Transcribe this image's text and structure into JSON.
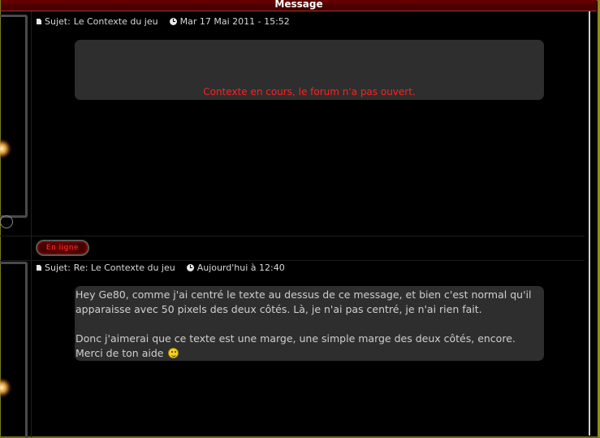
{
  "header": {
    "title": "Message"
  },
  "posts": [
    {
      "subject_prefix": "Sujet:",
      "subject": "Le Contexte du jeu",
      "date": "Mar 17 Mai 2011 - 15:52",
      "body": "Contexte en cours, le forum n'a pas ouvert.",
      "body_color": "#ff2020"
    },
    {
      "subject_prefix": "Sujet:",
      "subject": "Re: Le Contexte du jeu",
      "date": "Aujourd'hui à 12:40",
      "body_lines": [
        "Hey Ge80, comme j'ai centré le texte au dessus de ce message, et bien c'est normal qu'il",
        "apparaisse avec 50 pixels des deux côtés. Là, je n'ai pas centré, je n'ai rien fait.",
        "Donc j'aimerai que ce texte est une marge, une simple marge des deux côtés, encore.",
        "Merci de ton aide"
      ]
    }
  ],
  "online_badge": {
    "label": "En ligne",
    "color": "#ff3333"
  },
  "icons": {
    "subject": "document-icon",
    "date": "clock-icon",
    "emoticon": "smiley-icon"
  },
  "colors": {
    "header_bg": "#5a0000",
    "box_bg": "#2e2e2e",
    "page_bg": "#000000"
  }
}
